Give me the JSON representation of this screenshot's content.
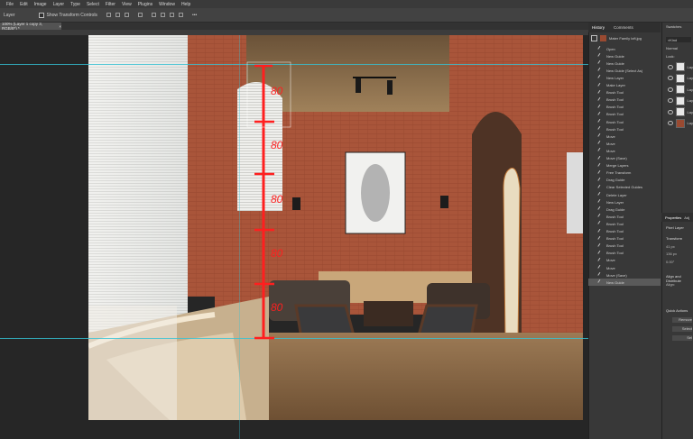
{
  "menu": [
    "File",
    "Edit",
    "Image",
    "Layer",
    "Type",
    "Select",
    "Filter",
    "View",
    "Plugins",
    "Window",
    "Help"
  ],
  "options": {
    "tool_label": "Layer",
    "show_transform": "Show Transform Controls"
  },
  "document": {
    "tab_title": "100% (Layer 1 copy 3, RGB/8*) *"
  },
  "history": {
    "tabs": [
      "History",
      "Comments"
    ],
    "snapshot": "Mater Family loft.jpg",
    "items": [
      "Open",
      "New Guide",
      "New Guide",
      "New Guide (Select As)",
      "New Layer",
      "Make Layer",
      "Brush Tool",
      "Brush Tool",
      "Brush Tool",
      "Brush Tool",
      "Brush Tool",
      "Brush Tool",
      "Move",
      "Move",
      "Move",
      "Move (Save)",
      "Merge Layers",
      "Free Transform",
      "Drag Guide",
      "Clear Selected Guides",
      "Delete Layer",
      "New Layer",
      "Drag Guide",
      "Brush Tool",
      "Brush Tool",
      "Brush Tool",
      "Brush Tool",
      "Brush Tool",
      "Brush Tool",
      "Move",
      "Move",
      "Move (Save)",
      "New Guide"
    ]
  },
  "layers": {
    "tabs": [
      "Swatches",
      "Gradients"
    ],
    "search": "Kind",
    "blend": "Normal",
    "lock_label": "Lock:",
    "rows": [
      "Lay",
      "Lay",
      "Lay",
      "Lay",
      "Lay",
      "Lay"
    ]
  },
  "properties": {
    "tabs": [
      "Properties",
      "Adj"
    ],
    "layer_label": "Pixel Layer",
    "transform": "Transform",
    "w": "41 px",
    "h": "136 px",
    "angle": "0.00°",
    "align": "Align and Distribute",
    "align_sub": "Align:",
    "quick_actions": "Quick Actions",
    "qa_btn1": "Remove",
    "qa_btn2": "Select",
    "qa_btn3": "Sel"
  },
  "annotations": {
    "labels": [
      "80",
      "80",
      "80",
      "80",
      "80"
    ]
  },
  "colors": {
    "guide": "#34c3d6",
    "annotation": "#ff1f1f"
  }
}
